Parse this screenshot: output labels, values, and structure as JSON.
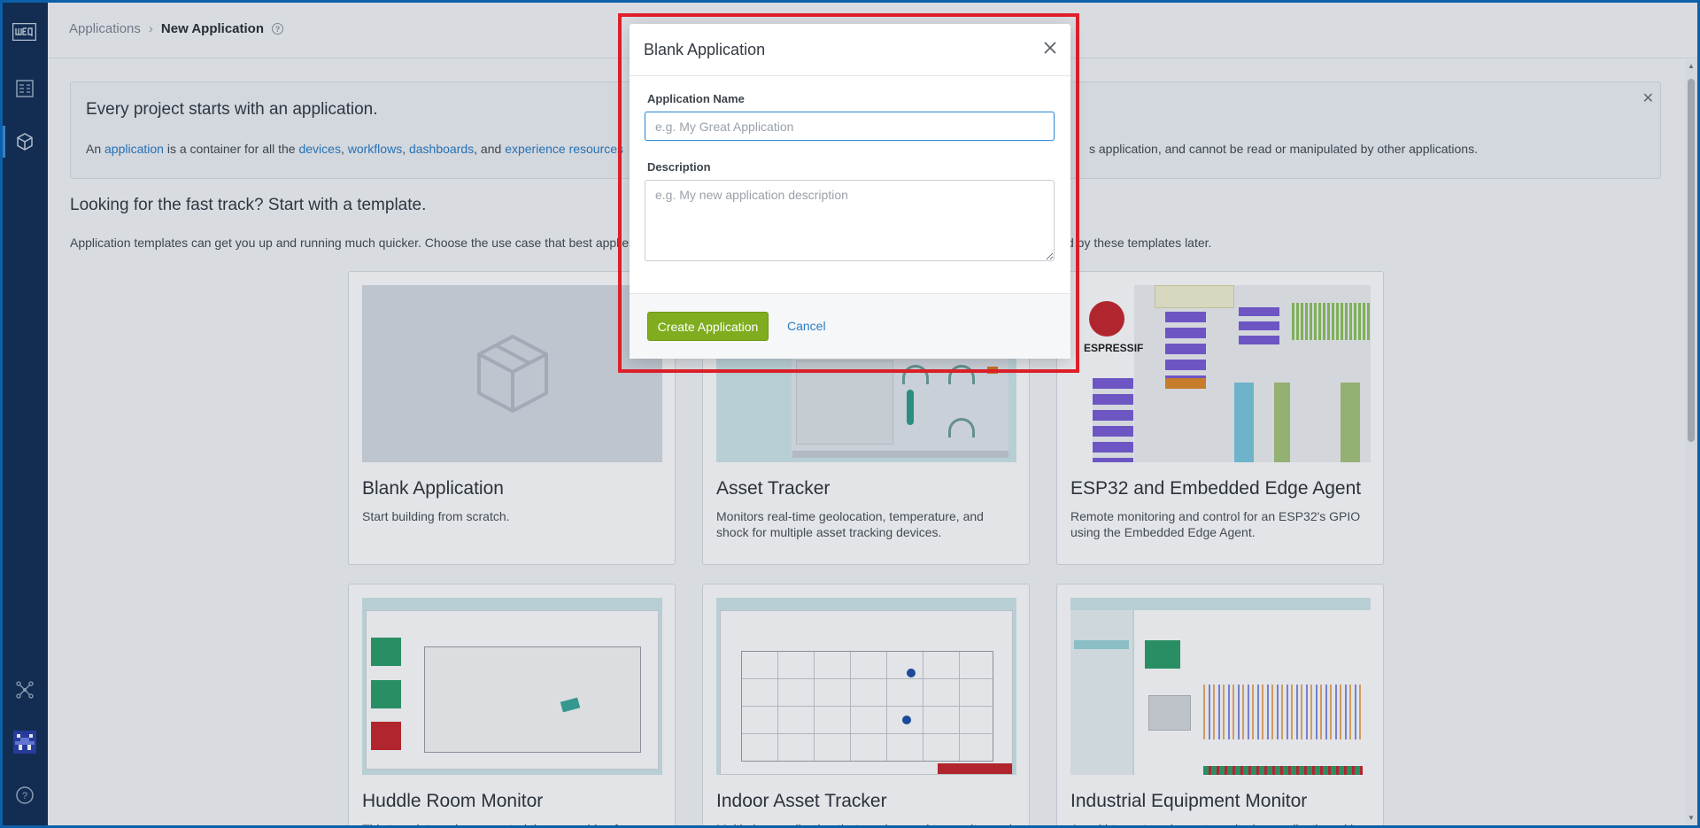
{
  "breadcrumb": {
    "parent": "Applications",
    "separator": "›",
    "current": "New Application"
  },
  "info": {
    "title": "Every project starts with an application.",
    "text_prefix": "An ",
    "link_application": "application",
    "text_mid": " is a container for all the ",
    "link_devices": "devices",
    "comma1": ", ",
    "link_workflows": "workflows",
    "comma2": ", ",
    "link_dashboards": "dashboards",
    "text_and": ", and ",
    "link_experience": "experience resources",
    "text_end": "s application, and cannot be read or manipulated by other applications."
  },
  "templates": {
    "heading": "Looking for the fast track? Start with a template.",
    "description_start": "Application templates can get you up and running much quicker. Choose the use case that best applies",
    "description_end": "d by these templates later."
  },
  "cards": [
    {
      "title": "Blank Application",
      "description": "Start building from scratch."
    },
    {
      "title": "Asset Tracker",
      "description": "Monitors real-time geolocation, temperature, and shock for multiple asset tracking devices."
    },
    {
      "title": "ESP32 and Embedded Edge Agent",
      "description": "Remote monitoring and control for an ESP32's GPIO using the Embedded Edge Agent.",
      "brand": "ESPRESSIF"
    },
    {
      "title": "Huddle Room Monitor",
      "description": "This template reduces wasted time searching for"
    },
    {
      "title": "Indoor Asset Tracker",
      "description": "Multi-view application that can be used to monitor and"
    },
    {
      "title": "Industrial Equipment Monitor",
      "description": "A multi-tenant equipment monitoring application with"
    }
  ],
  "modal": {
    "title": "Blank Application",
    "name_label": "Application Name",
    "name_placeholder": "e.g. My Great Application",
    "name_value": "",
    "description_label": "Description",
    "description_placeholder": "e.g. My new application description",
    "create_label": "Create Application",
    "cancel_label": "Cancel"
  },
  "colors": {
    "sidebar": "#132f55",
    "primary_button": "#7fad1f",
    "link": "#2a7dc4",
    "highlight": "#e0202a"
  }
}
